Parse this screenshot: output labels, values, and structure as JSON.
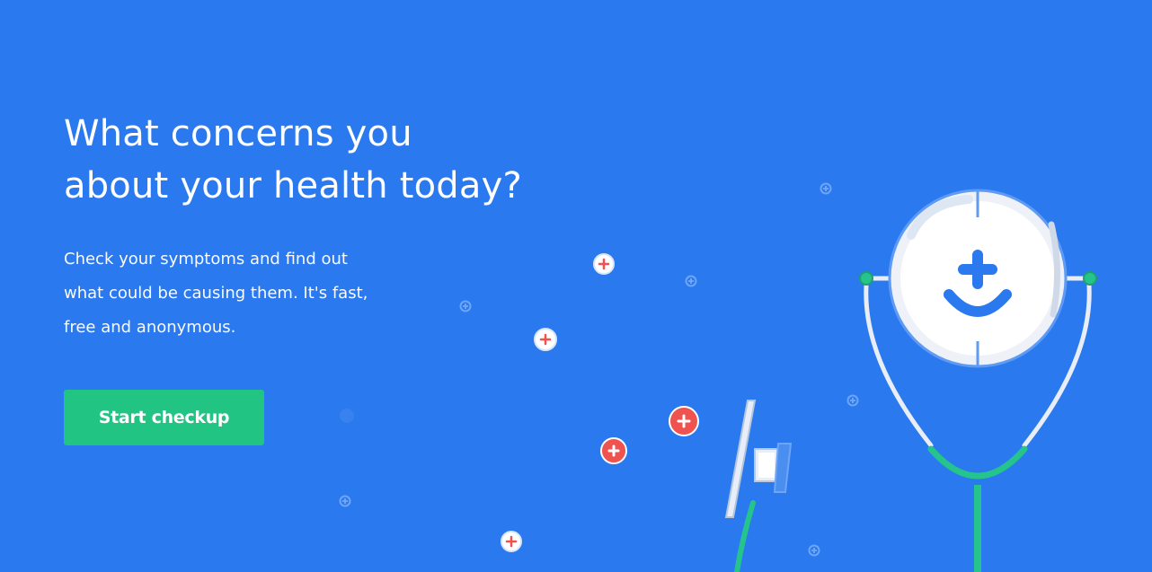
{
  "hero": {
    "headline_line1": "What concerns you",
    "headline_line2": "about your health today?",
    "subtext_line1": "Check your symptoms and find out",
    "subtext_line2": "what could be causing them. It's fast,",
    "subtext_line3": "free and anonymous.",
    "cta_label": "Start checkup"
  },
  "colors": {
    "background": "#2a79ef",
    "cta": "#21c483",
    "plus_red": "#ef5350",
    "stethoscope_green": "#26c48d"
  }
}
